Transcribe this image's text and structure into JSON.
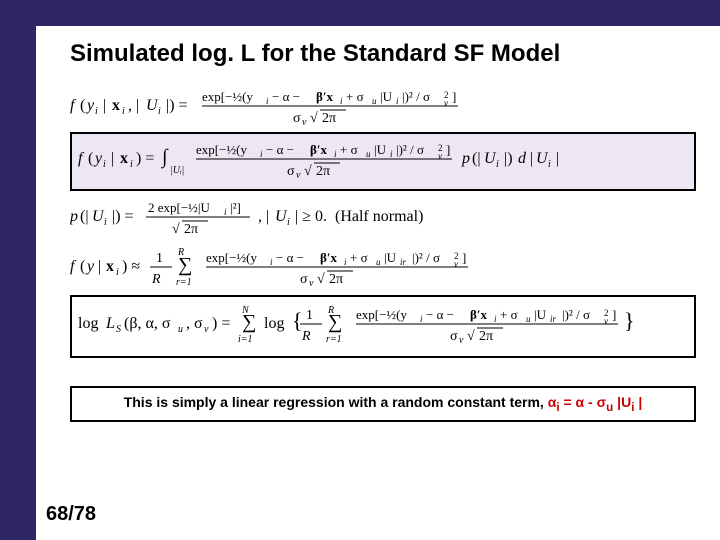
{
  "title": "Simulated log. L for the Standard SF Model",
  "note": {
    "lead": "This is simply a linear regression with a random constant term, ",
    "eq": "α",
    "sub1": "i",
    "mid": " = α - σ",
    "sub2": "u",
    "tail": " |U",
    "sub3": "i",
    "end": " |"
  },
  "pager": "68/78",
  "colors": {
    "banner": "#2e2663",
    "note_accent": "#cc0000"
  }
}
